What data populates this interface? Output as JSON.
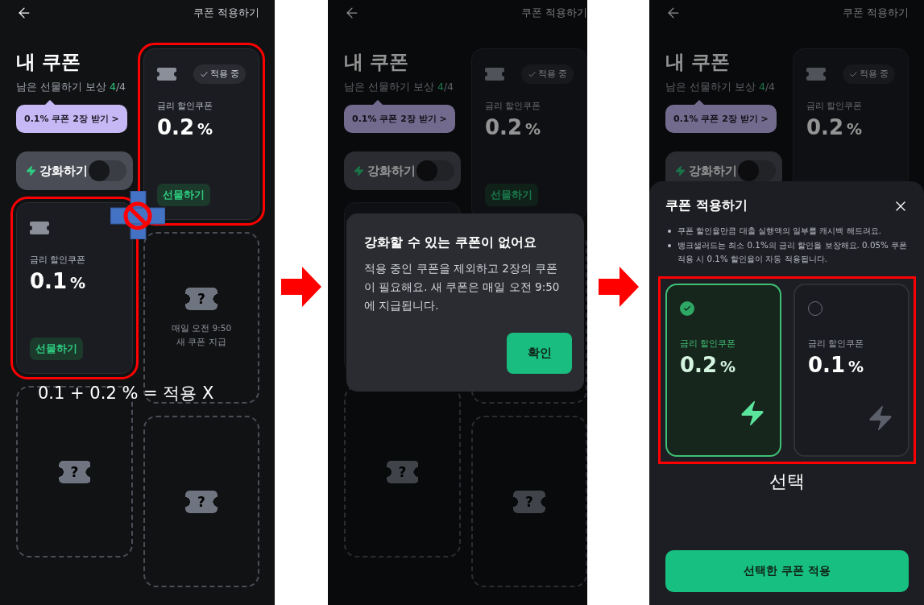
{
  "screens": [
    {
      "header": {
        "action": "쿠폰 적용하기"
      },
      "title": "내 쿠폰",
      "reward": {
        "label": "남은 선물하기 보상",
        "count": "4",
        "total": "/4"
      },
      "promo": "0.1% 쿠폰 2장 받기 >",
      "boost": {
        "label": "강화하기",
        "on": false
      },
      "coupons": [
        {
          "badge": "적용 중",
          "label": "금리 할인쿠폰",
          "value": "0.2",
          "unit": "%",
          "gift": "선물하기",
          "highlighted": true
        },
        {
          "label": "금리 할인쿠폰",
          "value": "0.1",
          "unit": "%",
          "gift": "선물하기",
          "highlighted": true
        }
      ],
      "slots": [
        {
          "kind": "timer",
          "symbol": "?",
          "note": [
            "매일 오전 9:50",
            "새 쿠폰 지급"
          ]
        },
        {
          "kind": "blank",
          "symbol": "?"
        },
        {
          "kind": "blank",
          "symbol": "?"
        }
      ],
      "merge_blocked": true,
      "annotation": "0.1 + 0.2 % = 적용 X",
      "dimmed": false
    },
    {
      "header": {
        "action": "쿠폰 적용하기"
      },
      "title": "내 쿠폰",
      "reward": {
        "label": "남은 선물하기 보상",
        "count": "4",
        "total": "/4"
      },
      "promo": "0.1% 쿠폰 2장 받기 >",
      "boost": {
        "label": "강화하기",
        "on": false
      },
      "coupons": [
        {
          "badge": "적용 중",
          "label": "금리 할인쿠폰",
          "value": "0.2",
          "unit": "%",
          "gift": "선물하기",
          "highlighted": false
        },
        {
          "highlighted": false
        }
      ],
      "slots": [
        {
          "kind": "frame"
        },
        {
          "kind": "blank",
          "symbol": "?"
        },
        {
          "kind": "blank",
          "symbol": "?"
        }
      ],
      "dimmed": true,
      "dialog": {
        "title": "강화할 수 있는 쿠폰이 없어요",
        "message": "적용 중인 쿠폰을 제외하고 2장의 쿠폰이 필요해요. 새 쿠폰은 매일 오전 9:50에 지급됩니다.",
        "confirm": "확인"
      }
    },
    {
      "header": {
        "action": "쿠폰 적용하기"
      },
      "title": "내 쿠폰",
      "reward": {
        "label": "남은 선물하기 보상",
        "count": "4",
        "total": "/4"
      },
      "promo": "0.1% 쿠폰 2장 받기 >",
      "boost": {
        "label": "강화하기",
        "on": false
      },
      "coupons": [
        {
          "badge": "적용 중",
          "label": "금리 할인쿠폰",
          "value": "0.2",
          "unit": "%",
          "highlighted": false
        }
      ],
      "dimmed": true,
      "sheet": {
        "title": "쿠폰 적용하기",
        "notes": [
          "쿠폰 할인율만큼 대출 실행액의 일부를 캐시백 해드려요.",
          "뱅크샐러드는 최소 0.1%의 금리 할인을 보장해요. 0.05% 쿠폰 적용 시 0.1% 할인율이 자동 적용됩니다."
        ],
        "options": [
          {
            "label": "금리 할인쿠폰",
            "value": "0.2",
            "unit": "%",
            "selected": true
          },
          {
            "label": "금리 할인쿠폰",
            "value": "0.1",
            "unit": "%",
            "selected": false
          }
        ],
        "options_highlighted": true,
        "annotation": "선택",
        "apply_button": "선택한 쿠폰 적용"
      }
    }
  ]
}
